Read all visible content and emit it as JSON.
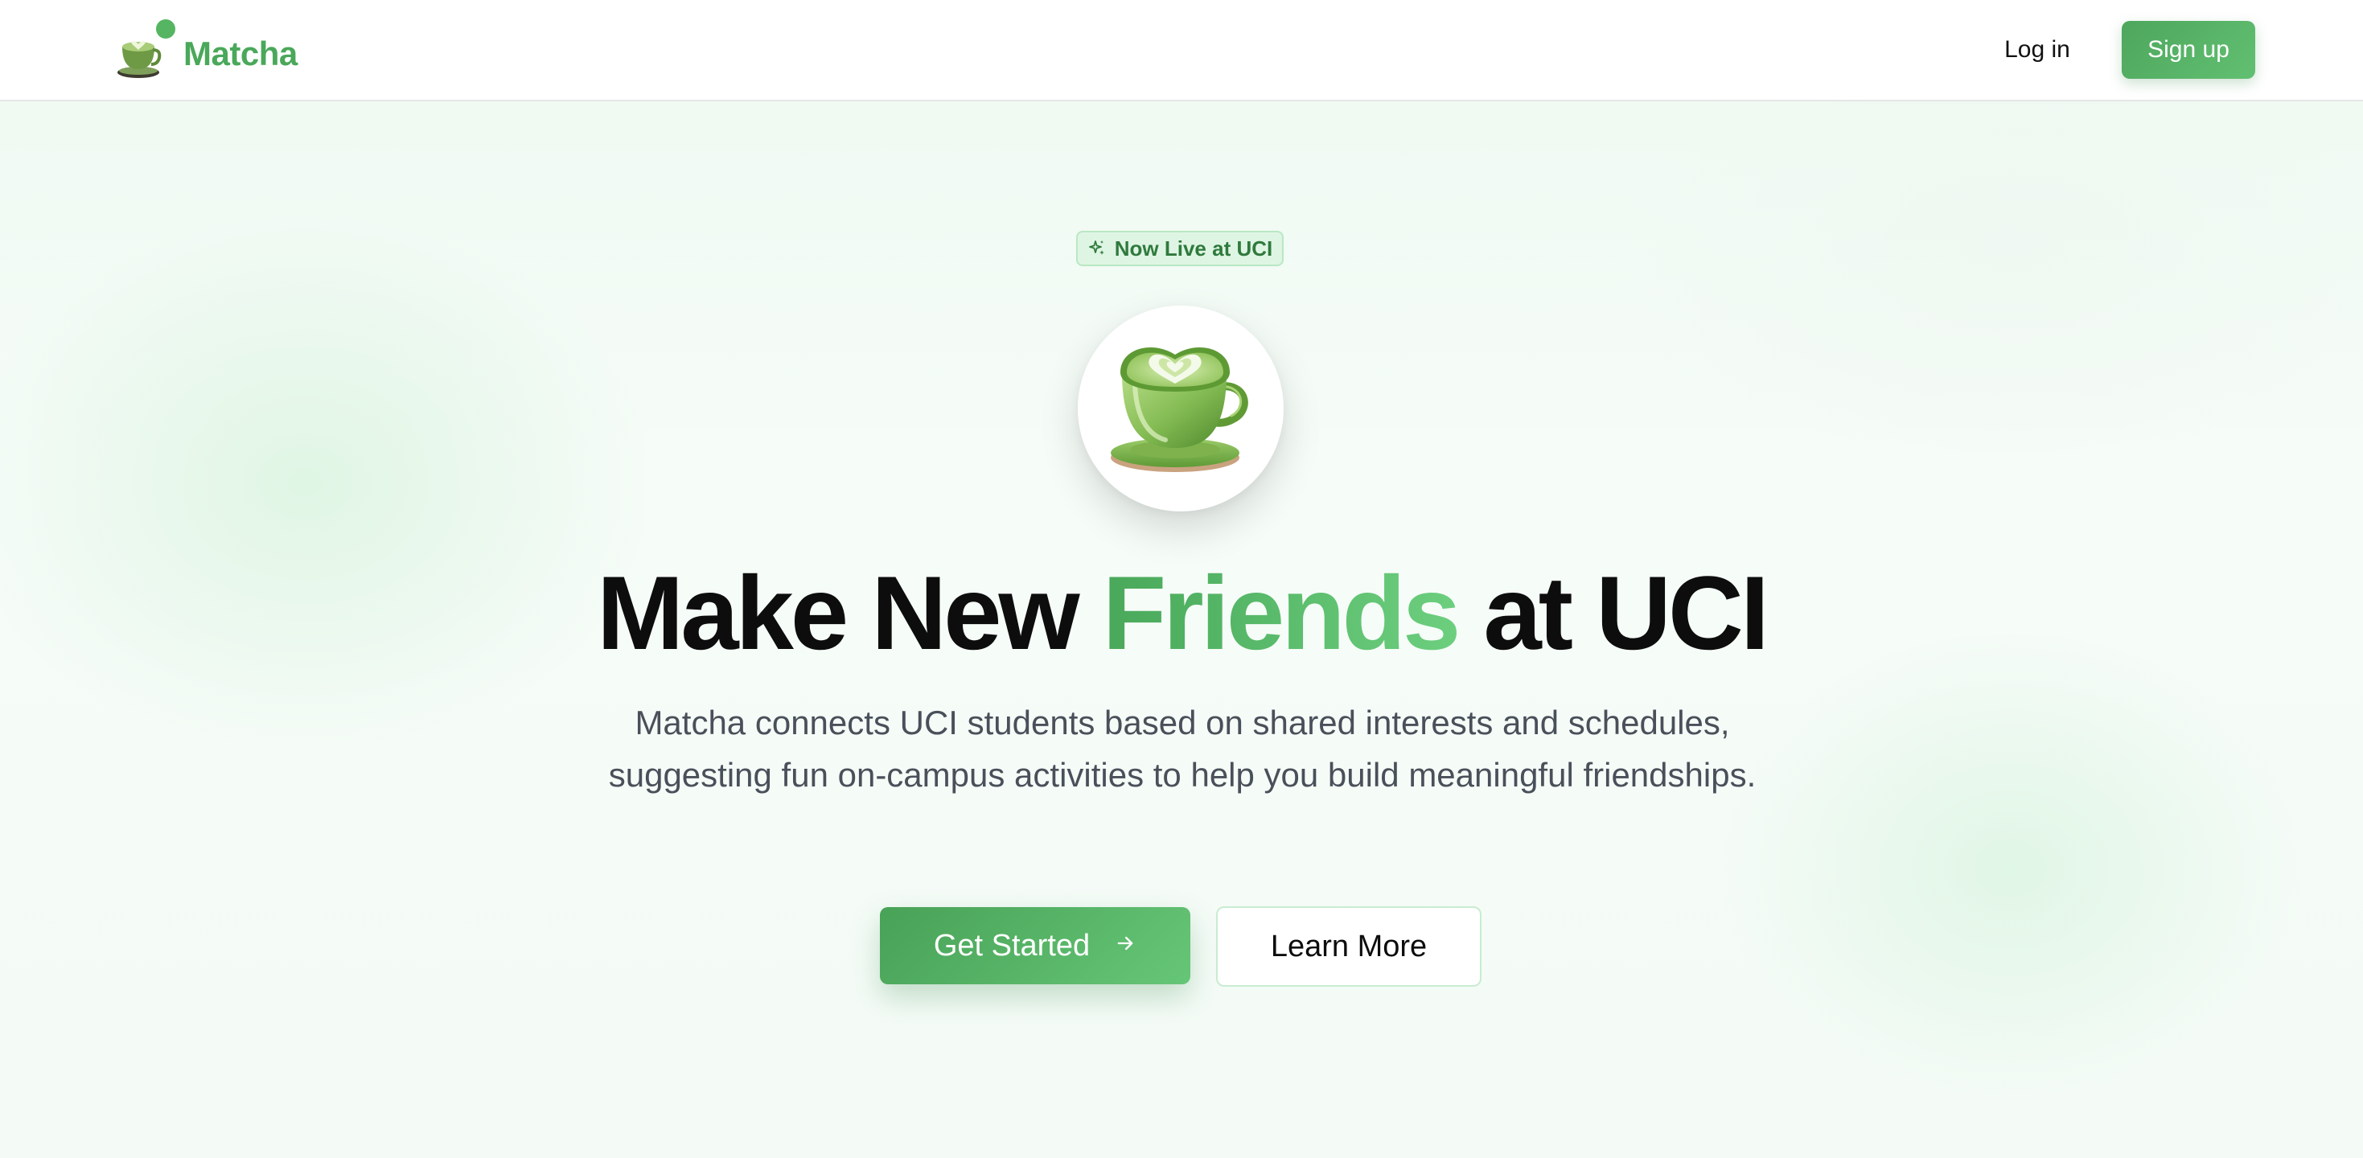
{
  "header": {
    "brand_name": "Matcha",
    "brand_logo_icon": "matcha-cup-icon",
    "login_label": "Log in",
    "signup_label": "Sign up"
  },
  "hero": {
    "badge_icon": "sparkles-icon",
    "badge_text": "Now Live at UCI",
    "illustration_icon": "matcha-latte-heart-cup-icon",
    "headline_before": "Make New ",
    "headline_accent": "Friends",
    "headline_after": " at UCI",
    "subtitle": "Matcha connects UCI students based on shared interests and schedules, suggesting fun on-campus activities to help you build meaningful friendships.",
    "primary_cta_label": "Get Started",
    "primary_cta_icon": "arrow-right-icon",
    "secondary_cta_label": "Learn More"
  },
  "colors": {
    "brand_green": "#4aa85a",
    "accent_light": "#6ccf7e",
    "badge_bg": "#dff5e4",
    "text_dark": "#0d0d0d",
    "text_muted": "#49505a"
  }
}
